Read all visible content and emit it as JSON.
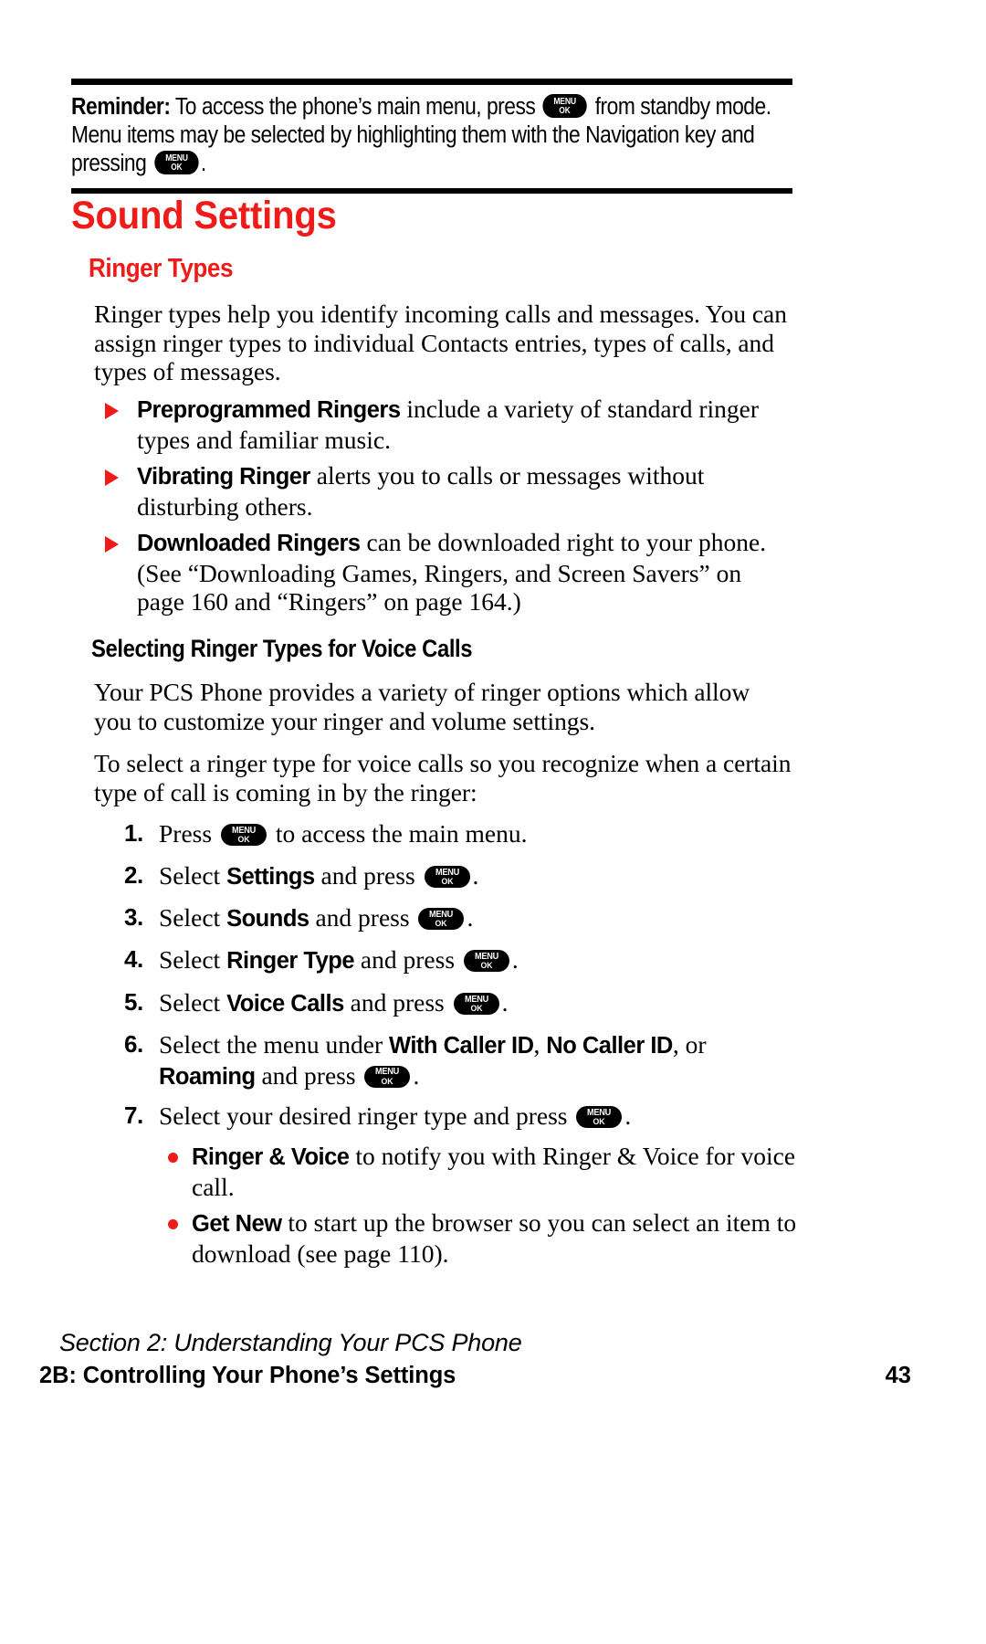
{
  "reminder": {
    "label": "Reminder:",
    "text_part1": " To access the phone’s main menu, press ",
    "key1": {
      "top": "MENU",
      "bottom": "OK"
    },
    "text_part2": " from standby mode. Menu items may be selected by highlighting them with the Navigation key and pressing ",
    "key2": {
      "top": "MENU",
      "bottom": "OK"
    },
    "text_part3": "."
  },
  "headings": {
    "title": "Sound Settings",
    "subtitle": "Ringer Types",
    "subsubtitle": "Selecting Ringer Types for Voice Calls"
  },
  "paragraphs": {
    "intro": "Ringer types help you identify incoming calls and messages. You can assign ringer types to individual Contacts entries, types of calls, and types of messages.",
    "voice_intro": "Your PCS Phone provides a variety of ringer options which allow you to customize your ringer and volume settings.",
    "voice_steps_intro": "To select a ringer type for voice calls so you recognize when a certain type of call is coming in by the ringer:"
  },
  "bullets": [
    {
      "lead": "Preprogrammed Ringers",
      "text": " include a variety of standard ringer types and familiar music."
    },
    {
      "lead": "Vibrating Ringer",
      "text": " alerts you to calls or messages without disturbing others."
    },
    {
      "lead": "Downloaded Ringers",
      "text": " can be downloaded right to your phone. (See “Downloading Games, Ringers, and Screen Savers” on page 160 and “Ringers” on page 164.)"
    }
  ],
  "steps": [
    {
      "num": "1.",
      "pre": "Press ",
      "key": {
        "top": "MENU",
        "bottom": "OK"
      },
      "post": " to access the main menu."
    },
    {
      "num": "2.",
      "pre": "Select ",
      "bold": "Settings",
      "mid": " and press ",
      "key": {
        "top": "MENU",
        "bottom": "OK"
      },
      "post": "."
    },
    {
      "num": "3.",
      "pre": "Select ",
      "bold": "Sounds",
      "mid": " and press ",
      "key": {
        "top": "MENU",
        "bottom": "OK"
      },
      "post": "."
    },
    {
      "num": "4.",
      "pre": "Select ",
      "bold": "Ringer Type",
      "mid": " and press ",
      "key": {
        "top": "MENU",
        "bottom": "OK"
      },
      "post": "."
    },
    {
      "num": "5.",
      "pre": "Select ",
      "bold": "Voice Calls",
      "mid": " and press ",
      "key": {
        "top": "MENU",
        "bottom": "OK"
      },
      "post": "."
    },
    {
      "num": "6.",
      "pre": "Select the menu under ",
      "bold1": "With Caller ID",
      "sep1": ", ",
      "bold2": "No Caller ID",
      "sep2": ", or ",
      "bold3": "Roaming",
      "mid": " and press ",
      "key": {
        "top": "MENU",
        "bottom": "OK"
      },
      "post": "."
    },
    {
      "num": "7.",
      "pre": "Select your desired ringer type and press ",
      "key": {
        "top": "MENU",
        "bottom": "OK"
      },
      "post": "."
    }
  ],
  "sub_bullets": [
    {
      "lead": "Ringer & Voice",
      "text": " to notify you with Ringer & Voice for voice call."
    },
    {
      "lead": "Get New",
      "text": " to start up the browser so you can select an item to download (see page 110)."
    }
  ],
  "footer": {
    "section": "Section 2: Understanding Your PCS Phone",
    "chapter": "2B: Controlling Your Phone’s Settings",
    "page_number": "43"
  },
  "colors": {
    "accent_red": "#ee1b18",
    "text_black": "#000000",
    "background": "#ffffff"
  }
}
